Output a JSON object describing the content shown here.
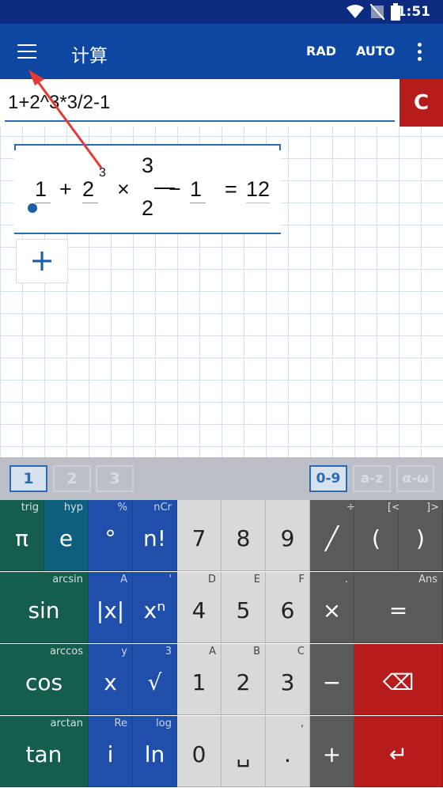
{
  "status_bar": {
    "time": "1:51"
  },
  "app_bar": {
    "title": "计算",
    "rad_label": "RAD",
    "auto_label": "AUTO"
  },
  "input": {
    "value": "1+2^3*3/2-1",
    "clear_label": "C"
  },
  "expression": {
    "terms": [
      "1",
      "+",
      "2",
      "3",
      "×",
      "3",
      "2",
      "−",
      "1",
      "=",
      "12"
    ]
  },
  "add_button": "+",
  "keyboard_tabs": {
    "pages": [
      "1",
      "2",
      "3"
    ],
    "active_page": "1",
    "modes": [
      "0-9",
      "a-z",
      "α-ω"
    ],
    "active_mode": "0-9"
  },
  "keys": {
    "r1": [
      {
        "main": "π",
        "sub": "trig"
      },
      {
        "main": "e",
        "sub": "hyp"
      },
      {
        "main": "°",
        "sub": "%"
      },
      {
        "main": "n!",
        "sub": "nCr"
      },
      {
        "main": "7",
        "sub": ""
      },
      {
        "main": "8",
        "sub": ""
      },
      {
        "main": "9",
        "sub": ""
      },
      {
        "main": "╱",
        "sub": "÷"
      },
      {
        "main": "(",
        "sub": "[<"
      },
      {
        "main": ")",
        "sub": "]>"
      }
    ],
    "r2": [
      {
        "main": "sin",
        "sub": "arcsin"
      },
      {
        "main": "|x|",
        "sub": "A"
      },
      {
        "main": "xⁿ",
        "sub": "'"
      },
      {
        "main": "4",
        "sub": "D"
      },
      {
        "main": "5",
        "sub": "E"
      },
      {
        "main": "6",
        "sub": "F"
      },
      {
        "main": "×",
        "sub": "."
      },
      {
        "main": "=",
        "sub": "Ans"
      }
    ],
    "r3": [
      {
        "main": "cos",
        "sub": "arccos"
      },
      {
        "main": "x",
        "sub": "y"
      },
      {
        "main": "√",
        "sub": "3"
      },
      {
        "main": "1",
        "sub": "A"
      },
      {
        "main": "2",
        "sub": "B"
      },
      {
        "main": "3",
        "sub": "C"
      },
      {
        "main": "−",
        "sub": ""
      },
      {
        "main": "⌫",
        "sub": ""
      }
    ],
    "r4": [
      {
        "main": "tan",
        "sub": "arctan"
      },
      {
        "main": "i",
        "sub": "Re"
      },
      {
        "main": "ln",
        "sub": "log"
      },
      {
        "main": "0",
        "sub": ""
      },
      {
        "main": "␣",
        "sub": ""
      },
      {
        "main": ".",
        "sub": ","
      },
      {
        "main": "+",
        "sub": ""
      },
      {
        "main": "↵",
        "sub": ""
      }
    ]
  },
  "colors": {
    "app_bar": "#0d47a1",
    "clear": "#b71c1c",
    "green_keys": "#155e4d",
    "blue_keys": "#1f4faa",
    "annotation_arrow": "#e53935"
  }
}
